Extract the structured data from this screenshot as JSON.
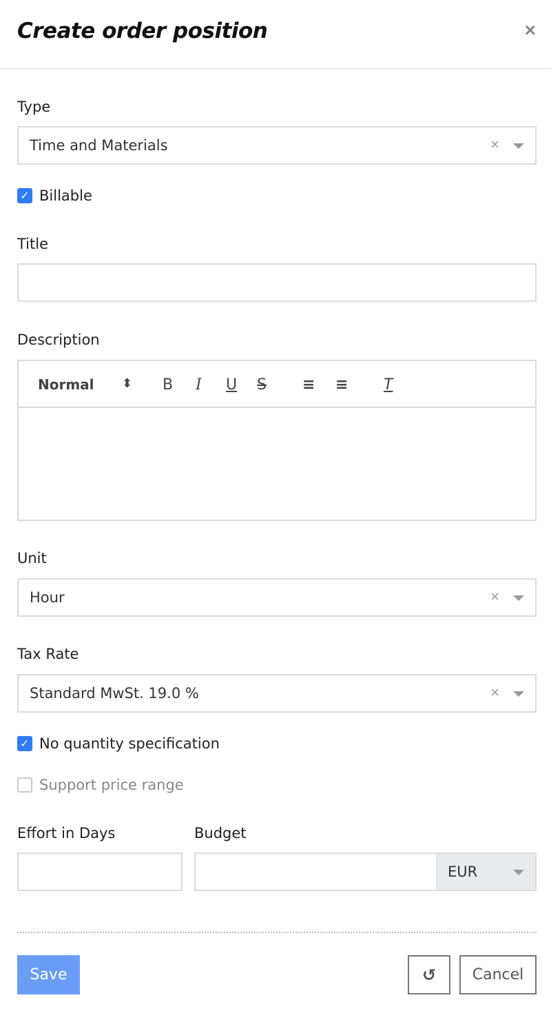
{
  "dialog": {
    "title": "Create order position",
    "close_icon": "×"
  },
  "fields": {
    "type": {
      "label": "Type",
      "value": "Time and Materials",
      "clear_icon": "×"
    },
    "billable": {
      "label": "Billable",
      "checked": true
    },
    "title": {
      "label": "Title",
      "value": ""
    },
    "description": {
      "label": "Description",
      "toolbar": {
        "format": "Normal",
        "format_arrows": "⬍",
        "bold": "B",
        "italic": "I",
        "underline": "U",
        "strike": "S",
        "ordered_list": "≡",
        "bullet_list": "≡",
        "clear_format": "T"
      }
    },
    "unit": {
      "label": "Unit",
      "value": "Hour",
      "clear_icon": "×"
    },
    "tax_rate": {
      "label": "Tax Rate",
      "value": "Standard MwSt. 19.0 %",
      "clear_icon": "×"
    },
    "no_quantity": {
      "label": "No quantity specification",
      "checked": true
    },
    "price_range": {
      "label": "Support price range",
      "checked": false
    },
    "effort": {
      "label": "Effort in Days",
      "value": ""
    },
    "budget": {
      "label": "Budget",
      "value": "",
      "currency": "EUR"
    }
  },
  "actions": {
    "save": "Save",
    "reset_icon": "↺",
    "cancel": "Cancel"
  },
  "colors": {
    "primary": "#6a9ef6",
    "checkbox": "#2e7cf6"
  }
}
